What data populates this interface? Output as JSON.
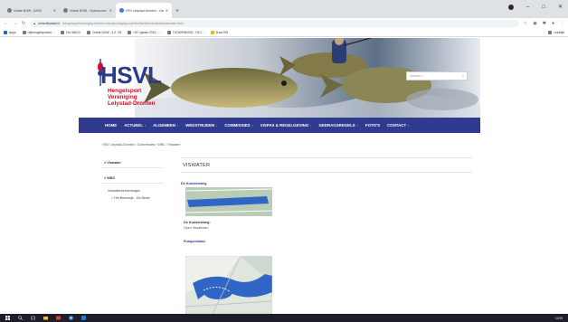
{
  "browser": {
    "tabs": [
      {
        "title": "Onsite NOW - A2HS"
      },
      {
        "title": "Onsite NOW - Opensource Ver"
      },
      {
        "title": "HSV Lelystad-Dronten - Viswater"
      }
    ],
    "new_tab_glyph": "+",
    "url_host": "ovhsvlelystad.nl",
    "url_rest": "/hengelsportvereniging-dronten-lelystad.staging.ovp/hsvl/hsvlnl/commissies/viswater.html",
    "window_controls": [
      "–",
      "□",
      "✕"
    ]
  },
  "bookmarks": [
    {
      "label": "Apps",
      "icon": "apps-icon"
    },
    {
      "label": "Hijmengeldpunten...",
      "icon": "globe-icon"
    },
    {
      "label": "Ted WAOV",
      "icon": "globe-icon"
    },
    {
      "label": "Onsite NOW - 4.2 / 52",
      "icon": "globe-icon"
    },
    {
      "label": "HG Update 2015 - ...",
      "icon": "globe-icon"
    },
    {
      "label": "TUDWENKING - HLC...",
      "icon": "globe-icon"
    },
    {
      "label": "Dock RM",
      "icon": "folder-icon"
    }
  ],
  "bookmarks_right": "Leeslijst",
  "site": {
    "logo_text": "HSVL",
    "logo_lines": [
      "Hengelsport",
      "Vereniging",
      "Lelystad-Dronten"
    ],
    "search_placeholder": "Zoeken...",
    "nav": [
      {
        "label": "HOME",
        "has_chevron": false
      },
      {
        "label": "ACTUEEL",
        "has_chevron": true
      },
      {
        "label": "ALGEMEEN",
        "has_chevron": true
      },
      {
        "label": "WEDSTRIJDEN",
        "has_chevron": true
      },
      {
        "label": "COMMISSIES",
        "has_chevron": true
      },
      {
        "label": "VISPAS & REGELGEVING",
        "has_chevron": true
      },
      {
        "label": "GEDRAGSREGELS",
        "has_chevron": true
      },
      {
        "label": "FOTO'S",
        "has_chevron": false
      },
      {
        "label": "CONTACT",
        "has_chevron": true
      }
    ],
    "breadcrumb": "HSV Lelystad-Dronten  /  Commissies  /  WBC  /  Viswater",
    "sidebar": {
      "items": [
        "> Viswater",
        "> WBC"
      ],
      "sub": "Vis/waterbeheer/regen",
      "subsub": "> Het Bernuwje - De Bever"
    },
    "content": {
      "heading": "VISWATER",
      "sections": [
        {
          "title": "De Kunstenweg",
          "caption": "De Kunstenweg:",
          "caption_sub": "Open Visplannen"
        },
        {
          "title": "Pumperslaan"
        }
      ]
    }
  },
  "taskbar": {
    "icons": [
      "windows-start-icon",
      "search-icon",
      "task-view-icon",
      "file-explorer-icon",
      "mail-icon",
      "chrome-icon",
      "app-icon"
    ],
    "clock": "10:09"
  },
  "colors": {
    "nav_bg": "#303a8e",
    "logo_blue": "#2b3a8c",
    "logo_red": "#c8102e",
    "map_water": "#2f66c6",
    "map_land": "#7fa68c"
  }
}
